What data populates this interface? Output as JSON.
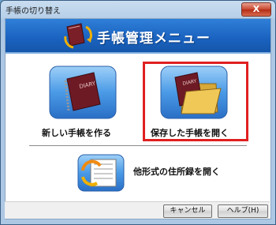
{
  "window": {
    "title": "手帳の切り替え",
    "close_label": "X"
  },
  "banner": {
    "title": "手帳管理メニュー",
    "icon": "diary-switch-icon"
  },
  "options": {
    "new_diary": {
      "label": "新しい手帳を作る",
      "icon_text": "DIARY"
    },
    "open_saved": {
      "label": "保存した手帳を開く",
      "icon_text": "DIARY"
    },
    "open_address_book": {
      "label": "他形式の住所録を開く"
    }
  },
  "footer": {
    "cancel_label": "キャンセル",
    "help_label": "ヘルプ(H)"
  },
  "colors": {
    "banner": "#1a62bf",
    "highlight": "#e02020"
  }
}
